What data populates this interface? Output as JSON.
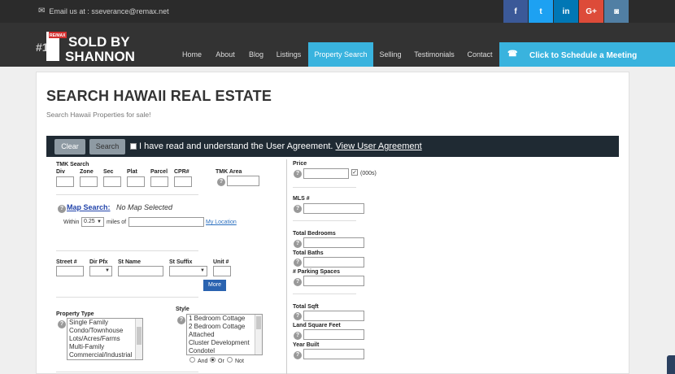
{
  "topbar": {
    "email": "Email us at : sseverance@remax.net",
    "social": [
      {
        "icon": "facebook-icon",
        "glyph": "f",
        "color": "#3b5998"
      },
      {
        "icon": "twitter-icon",
        "glyph": "t",
        "color": "#1da1f2"
      },
      {
        "icon": "linkedin-icon",
        "glyph": "in",
        "color": "#0077b5"
      },
      {
        "icon": "google-plus-icon",
        "glyph": "G+",
        "color": "#dd4b39"
      },
      {
        "icon": "instagram-icon",
        "glyph": "◙",
        "color": "#517fa4"
      }
    ]
  },
  "logo": {
    "line1": "SOLD BY",
    "line2": "SHANNON",
    "badge": "RE/MAX",
    "prefix": "#1"
  },
  "nav": {
    "items": [
      "Home",
      "About",
      "Blog",
      "Listings",
      "Property Search",
      "Selling",
      "Testimonials",
      "Contact"
    ],
    "active": "Property Search",
    "schedule": "Click to Schedule a Meeting"
  },
  "page": {
    "title": "SEARCH HAWAII REAL ESTATE",
    "subtitle": "Search Hawaii Properties for sale!"
  },
  "toolbar": {
    "clear": "Clear",
    "search": "Search",
    "agreement": "I have read and understand the User Agreement.",
    "agreement_link": "View User Agreement"
  },
  "form": {
    "tmk_search": "TMK Search",
    "tmk_fields": [
      "Div",
      "Zone",
      "Sec",
      "Plat",
      "Parcel",
      "CPR#"
    ],
    "tmk_area": "TMK Area",
    "map_search": "Map Search:",
    "no_map": "No Map Selected",
    "within": "Within",
    "miles_value": "0.25",
    "miles_of": "miles of",
    "my_location": "My Location",
    "street_fields": [
      "Street #",
      "Dir Pfx",
      "St Name",
      "St Suffix",
      "Unit #"
    ],
    "more": "More",
    "property_type": "Property Type",
    "property_types": [
      "Single Family",
      "Condo/Townhouse",
      "Lots/Acres/Farms",
      "Multi-Family",
      "Commercial/Industrial"
    ],
    "style": "Style",
    "styles": [
      "1 Bedroom Cottage",
      "2 Bedroom Cottage",
      "Attached",
      "Cluster Development",
      "Condotel"
    ],
    "logic": [
      "And",
      "Or",
      "Not"
    ],
    "logic_selected": "Or",
    "price": "Price",
    "price_unit": "(000s)",
    "mls": "MLS #",
    "total_bedrooms": "Total Bedrooms",
    "total_baths": "Total Baths",
    "parking": "# Parking Spaces",
    "total_sqft": "Total Sqft",
    "land_sqft": "Land Square Feet",
    "year_built": "Year Built"
  }
}
